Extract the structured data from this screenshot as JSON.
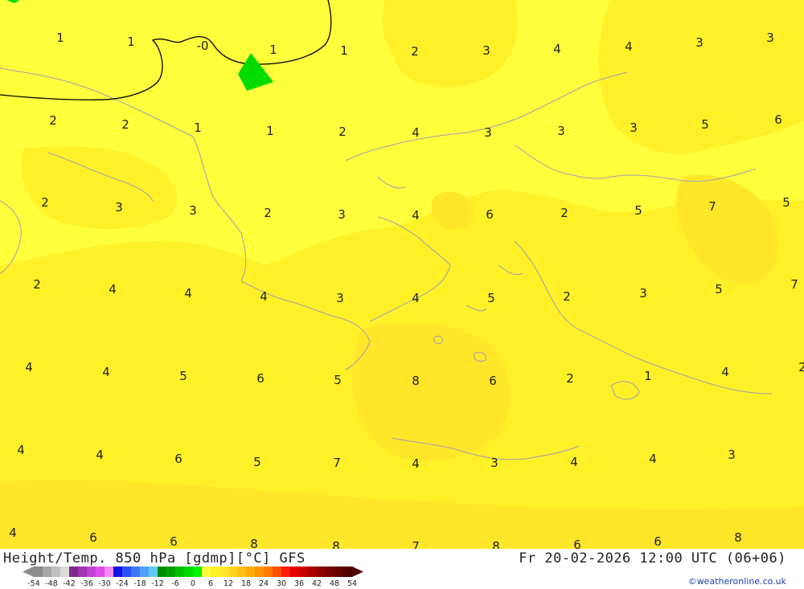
{
  "title": "Height/Temp. 850 hPa [gdmp][°C] GFS",
  "valid_time": "Fr 20-02-2026 12:00 UTC (06+06)",
  "credit": "©weatheronline.co.uk",
  "colorbar": {
    "ticks": [
      "-54",
      "-48",
      "-42",
      "-36",
      "-30",
      "-24",
      "-18",
      "-12",
      "-6",
      "0",
      "6",
      "12",
      "18",
      "24",
      "30",
      "36",
      "42",
      "48",
      "54"
    ],
    "colors": [
      "#8c8c8c",
      "#a6a6a6",
      "#c0c0c0",
      "#dcdcdc",
      "#7d2a8c",
      "#a235b4",
      "#c440d4",
      "#e04ee8",
      "#f08cf2",
      "#1414e6",
      "#2850f0",
      "#3c78f5",
      "#50a0fa",
      "#64c8ff",
      "#008c00",
      "#00a000",
      "#00be00",
      "#00dc00",
      "#00f000",
      "#ffff3c",
      "#fff028",
      "#ffe628",
      "#ffd21e",
      "#ffbe14",
      "#ffaa0a",
      "#ff9600",
      "#ff7800",
      "#ff5000",
      "#ff1e00",
      "#e60000",
      "#c80000",
      "#aa0000",
      "#8c0000",
      "#780000",
      "#640000",
      "#500000"
    ]
  },
  "isotherm_labels": [
    {
      "text": "1"
    },
    {
      "text": "1"
    },
    {
      "text": "-0"
    },
    {
      "text": "1"
    },
    {
      "text": "1"
    },
    {
      "text": "2"
    },
    {
      "text": "3"
    },
    {
      "text": "4"
    },
    {
      "text": "4"
    },
    {
      "text": "3"
    },
    {
      "text": "3"
    },
    {
      "text": "2"
    },
    {
      "text": "2"
    },
    {
      "text": "1"
    },
    {
      "text": "1"
    },
    {
      "text": "2"
    },
    {
      "text": "4"
    },
    {
      "text": "3"
    },
    {
      "text": "3"
    },
    {
      "text": "3"
    },
    {
      "text": "5"
    },
    {
      "text": "6"
    },
    {
      "text": "2"
    },
    {
      "text": "3"
    },
    {
      "text": "3"
    },
    {
      "text": "2"
    },
    {
      "text": "3"
    },
    {
      "text": "4"
    },
    {
      "text": "6"
    },
    {
      "text": "2"
    },
    {
      "text": "5"
    },
    {
      "text": "7"
    },
    {
      "text": "5"
    },
    {
      "text": "2"
    },
    {
      "text": "4"
    },
    {
      "text": "4"
    },
    {
      "text": "4"
    },
    {
      "text": "3"
    },
    {
      "text": "4"
    },
    {
      "text": "5"
    },
    {
      "text": "2"
    },
    {
      "text": "3"
    },
    {
      "text": "5"
    },
    {
      "text": "7"
    },
    {
      "text": "4"
    },
    {
      "text": "4"
    },
    {
      "text": "5"
    },
    {
      "text": "6"
    },
    {
      "text": "5"
    },
    {
      "text": "8"
    },
    {
      "text": "6"
    },
    {
      "text": "2"
    },
    {
      "text": "1"
    },
    {
      "text": "4"
    },
    {
      "text": "2"
    },
    {
      "text": "4"
    },
    {
      "text": "4"
    },
    {
      "text": "6"
    },
    {
      "text": "5"
    },
    {
      "text": "7"
    },
    {
      "text": "4"
    },
    {
      "text": "3"
    },
    {
      "text": "4"
    },
    {
      "text": "4"
    },
    {
      "text": "3"
    },
    {
      "text": "4"
    },
    {
      "text": "6"
    },
    {
      "text": "6"
    },
    {
      "text": "8"
    },
    {
      "text": "8"
    },
    {
      "text": "7"
    },
    {
      "text": "8"
    },
    {
      "text": "6"
    },
    {
      "text": "6"
    },
    {
      "text": "8"
    }
  ]
}
